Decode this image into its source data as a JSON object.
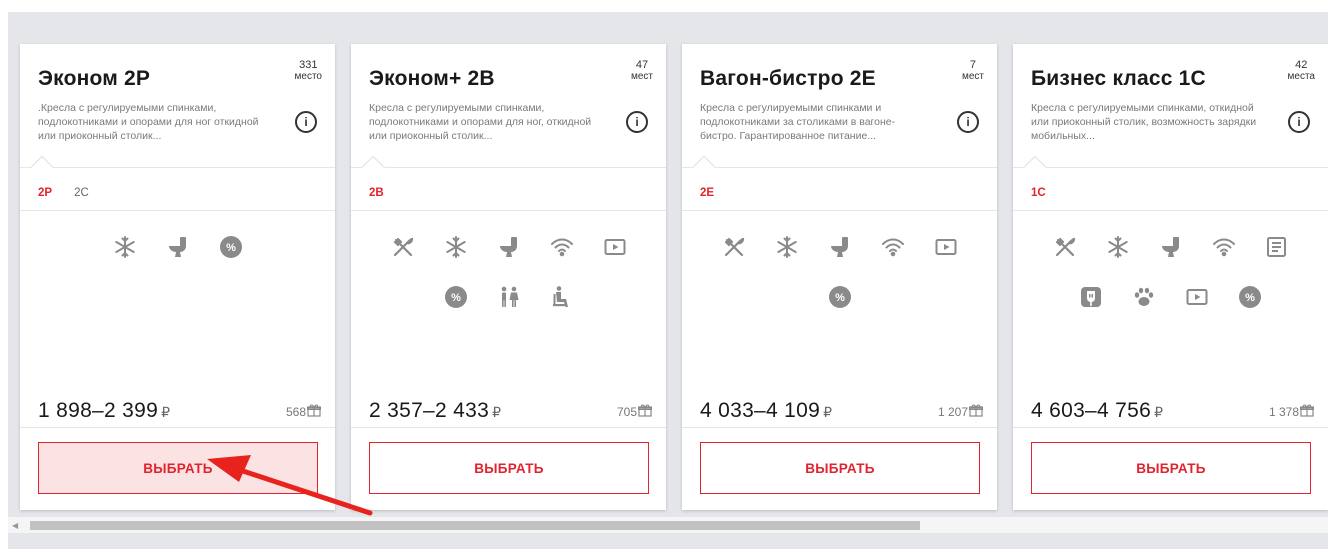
{
  "colors": {
    "accent": "#e0242e",
    "icon": "#8a8a8a",
    "panel": "#e4e6ea"
  },
  "cards": [
    {
      "title": "Эконом 2Р",
      "seats_count": "331",
      "seats_unit": "место",
      "description": ".Кресла с регулируемыми спинками, подлокотниками и опорами для ног откидной или приоконный столик...",
      "subclasses": [
        "2Р",
        "2С"
      ],
      "icons": [
        "snowflake-icon",
        "toilet-icon",
        "discount-icon"
      ],
      "price": "1 898–2 399",
      "currency": "₽",
      "bonus": "568",
      "button_label": "ВЫБРАТЬ"
    },
    {
      "title": "Эконом+ 2В",
      "seats_count": "47",
      "seats_unit": "мест",
      "description": "Кресла с регулируемыми спинками, подлокотниками и опорами для ног, откидной или приоконный столик...",
      "subclasses": [
        "2В"
      ],
      "icons": [
        "meal-icon",
        "snowflake-icon",
        "toilet-icon",
        "wifi-icon",
        "video-icon",
        "discount-icon",
        "family-icon",
        "seat-icon"
      ],
      "price": "2 357–2 433",
      "currency": "₽",
      "bonus": "705",
      "button_label": "ВЫБРАТЬ"
    },
    {
      "title": "Вагон-бистро 2Е",
      "seats_count": "7",
      "seats_unit": "мест",
      "description": "Кресла с регулируемыми спинками и подлокотниками за столиками в вагоне-бистро. Гарантированное питание...",
      "subclasses": [
        "2Е"
      ],
      "icons": [
        "meal-icon",
        "snowflake-icon",
        "toilet-icon",
        "wifi-icon",
        "video-icon",
        "discount-icon"
      ],
      "price": "4 033–4 109",
      "currency": "₽",
      "bonus": "1 207",
      "button_label": "ВЫБРАТЬ"
    },
    {
      "title": "Бизнес класс 1С",
      "seats_count": "42",
      "seats_unit": "места",
      "description": "Кресла с регулируемыми спинками, откидной или приоконный столик, возможность зарядки мобильных...",
      "subclasses": [
        "1С"
      ],
      "icons": [
        "meal-icon",
        "snowflake-icon",
        "toilet-icon",
        "wifi-icon",
        "press-icon",
        "socket-icon",
        "pet-icon",
        "video-icon",
        "discount-icon"
      ],
      "price": "4 603–4 756",
      "currency": "₽",
      "bonus": "1 378",
      "button_label": "ВЫБРАТЬ"
    }
  ]
}
